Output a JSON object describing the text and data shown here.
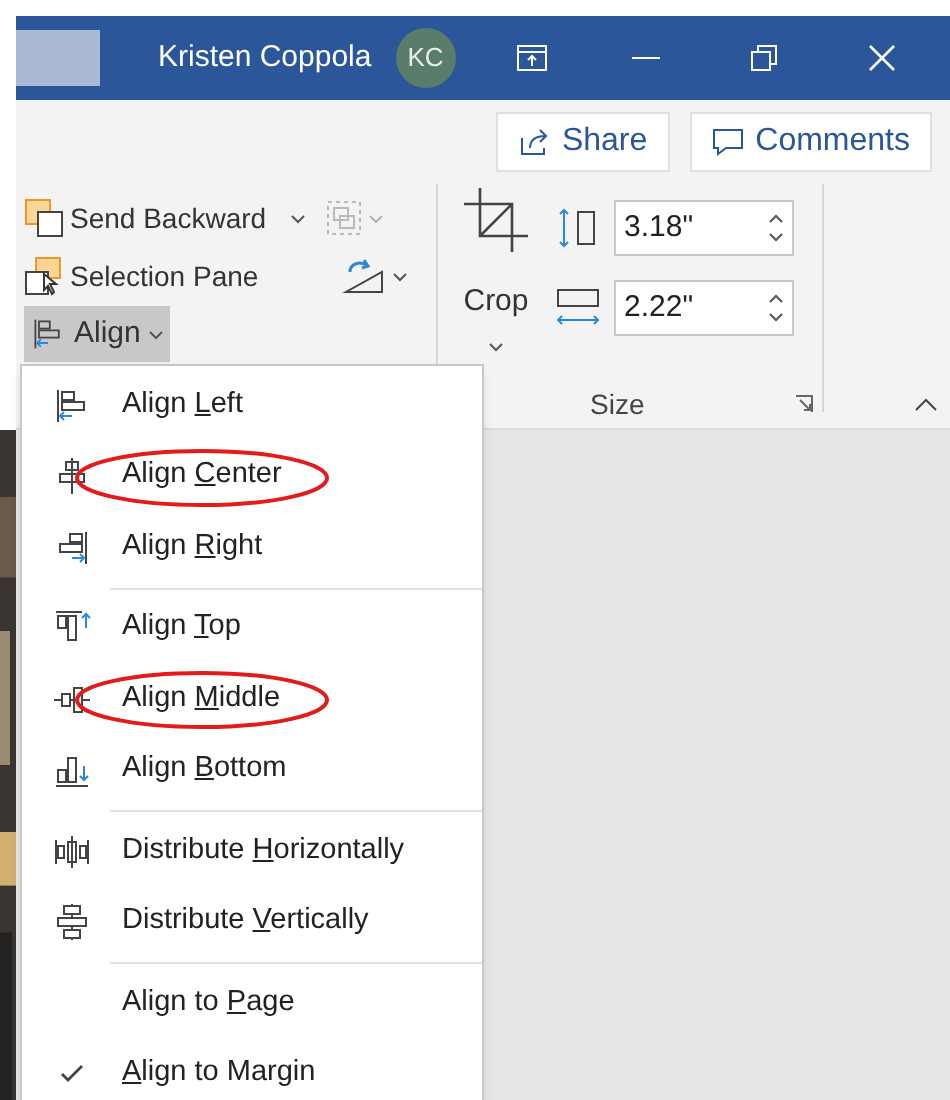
{
  "title_bar": {
    "user_name": "Kristen Coppola",
    "avatar_initials": "KC"
  },
  "share_button": {
    "label": "Share"
  },
  "comments_button": {
    "label": "Comments"
  },
  "arrange_group": {
    "send_backward": {
      "label": "Send Backward"
    },
    "selection_pane": {
      "label": "Selection Pane"
    },
    "align_button": {
      "label": "Align",
      "selected": true
    },
    "group_button": {
      "disabled": true
    }
  },
  "size_group": {
    "crop_label": "Crop",
    "height_value": "3.18\"",
    "width_value": "2.22\"",
    "label": "Size"
  },
  "align_menu": {
    "sections": [
      {
        "items": [
          {
            "before": "Align ",
            "access_key": "L",
            "after": "eft",
            "circled": false,
            "checked": false
          },
          {
            "before": "Align ",
            "access_key": "C",
            "after": "enter",
            "circled": true,
            "checked": false
          },
          {
            "before": "Align ",
            "access_key": "R",
            "after": "ight",
            "circled": false,
            "checked": false
          }
        ]
      },
      {
        "items": [
          {
            "before": "Align ",
            "access_key": "T",
            "after": "op",
            "circled": false,
            "checked": false
          },
          {
            "before": "Align ",
            "access_key": "M",
            "after": "iddle",
            "circled": true,
            "checked": false
          },
          {
            "before": "Align ",
            "access_key": "B",
            "after": "ottom",
            "circled": false,
            "checked": false
          }
        ]
      },
      {
        "items": [
          {
            "before": "Distribute ",
            "access_key": "H",
            "after": "orizontally",
            "circled": false,
            "checked": false
          },
          {
            "before": "Distribute ",
            "access_key": "V",
            "after": "ertically",
            "circled": false,
            "checked": false
          }
        ]
      },
      {
        "items": [
          {
            "before": "Align to ",
            "access_key": "P",
            "after": "age",
            "circled": false,
            "checked": false
          },
          {
            "access_key": "A",
            "after": "lign to Margin",
            "circled": false,
            "checked": true
          }
        ]
      }
    ]
  }
}
